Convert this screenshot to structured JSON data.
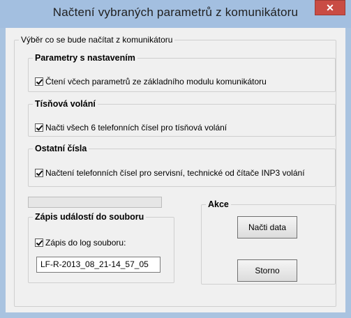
{
  "window": {
    "title": "Načtení vybraných parametrů z komunikátoru",
    "close_glyph": "✕"
  },
  "main_group": {
    "label": "Výběr co se bude načítat z komunikátoru"
  },
  "params_group": {
    "label": "Parametry s nastavením",
    "checkbox_label": "Čtení včech parametrů ze základního modulu komunikátoru",
    "checked": true
  },
  "emergency_group": {
    "label": "Tísňová volání",
    "checkbox_label": "Načti všech 6 telefonních čísel pro tísňová volání",
    "checked": true
  },
  "other_group": {
    "label": "Ostatní čísla",
    "checkbox_label": "Načtení telefonních čísel pro servisní, technické od čítače INP3 volání",
    "checked": true
  },
  "progress": {
    "value": 0
  },
  "log_group": {
    "label": "Zápis událostí do souboru",
    "checkbox_label": "Zápis do log souboru:",
    "checked": true,
    "filename_value": "LF-R-2013_08_21-14_57_05"
  },
  "actions_group": {
    "label": "Akce",
    "load_button": "Načti data",
    "cancel_button": "Storno"
  },
  "colors": {
    "title_bar": "#a3bfe0",
    "close_button": "#c94c44",
    "dialog_background": "#f0f0f0"
  },
  "icons": {
    "close": "close-icon",
    "checkbox": "checkmark-icon"
  }
}
